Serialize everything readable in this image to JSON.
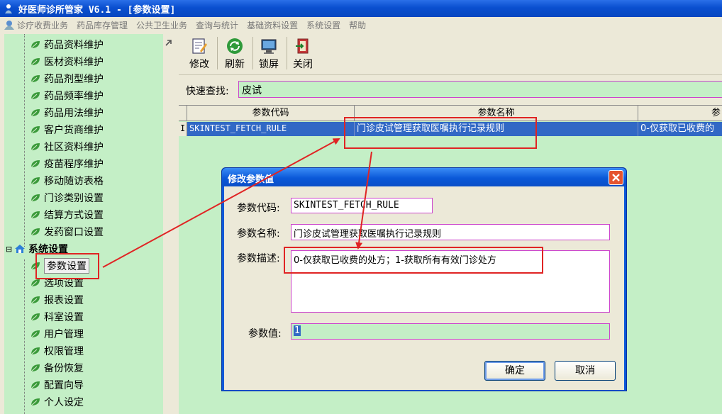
{
  "window": {
    "title": "好医师诊所管家 V6.1 - [参数设置]"
  },
  "menu": {
    "items": [
      "诊疗收费业务",
      "药品库存管理",
      "公共卫生业务",
      "查询与统计",
      "基础资料设置",
      "系统设置",
      "帮助"
    ]
  },
  "sidebar": {
    "items": [
      {
        "label": "药品资料维护"
      },
      {
        "label": "医材资料维护"
      },
      {
        "label": "药品剂型维护"
      },
      {
        "label": "药品频率维护"
      },
      {
        "label": "药品用法维护"
      },
      {
        "label": "客户货商维护"
      },
      {
        "label": "社区资料维护"
      },
      {
        "label": "疫苗程序维护"
      },
      {
        "label": "移动随访表格"
      },
      {
        "label": "门诊类别设置"
      },
      {
        "label": "结算方式设置"
      },
      {
        "label": "发药窗口设置"
      }
    ],
    "group": {
      "label": "系统设置",
      "expander": "⊟"
    },
    "group_items": [
      {
        "label": "参数设置"
      },
      {
        "label": "选项设置"
      },
      {
        "label": "报表设置"
      },
      {
        "label": "科室设置"
      },
      {
        "label": "用户管理"
      },
      {
        "label": "权限管理"
      },
      {
        "label": "备份恢复"
      },
      {
        "label": "配置向导"
      },
      {
        "label": "个人设定"
      }
    ]
  },
  "toolbar": {
    "edit_label": "修改",
    "refresh_label": "刷新",
    "lock_label": "锁屏",
    "close_label": "关闭"
  },
  "search": {
    "label": "快速查找:",
    "value": "皮试"
  },
  "grid": {
    "columns": [
      "参数代码",
      "参数名称",
      "参"
    ],
    "row_marker": "I",
    "rows": [
      {
        "code": "SKINTEST_FETCH_RULE",
        "name": "门诊皮试管理获取医嘱执行记录规则",
        "desc": "0-仅获取已收费的"
      }
    ]
  },
  "dialog": {
    "title": "修改参数值",
    "code_label": "参数代码:",
    "code_value": "SKINTEST_FETCH_RULE",
    "name_label": "参数名称:",
    "name_value": "门诊皮试管理获取医嘱执行记录规则",
    "desc_label": "参数描述:",
    "desc_value": "0-仅获取已收费的处方；1-获取所有有效门诊处方",
    "value_label": "参数值:",
    "value": "1",
    "ok_label": "确定",
    "cancel_label": "取消"
  },
  "colors": {
    "accent_green": "#c4efc6",
    "selection_blue": "#3168c5",
    "titlebar_blue": "#0a58d8",
    "annotation_red": "#e02424",
    "field_border": "#cc44cc"
  }
}
